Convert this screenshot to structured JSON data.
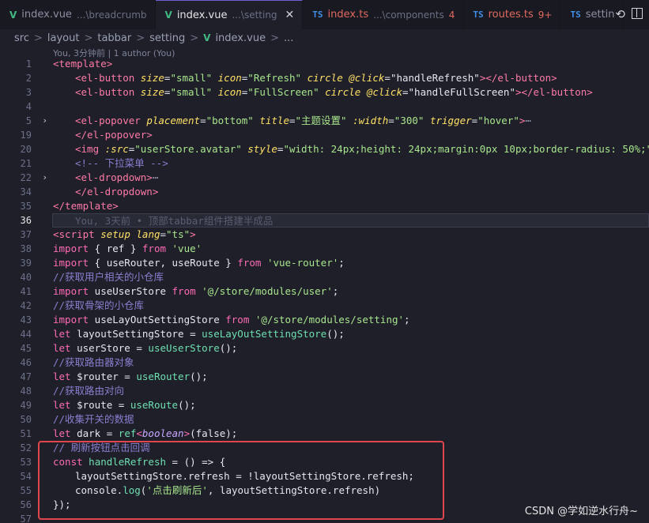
{
  "tabs": [
    {
      "icon": "vue-icon",
      "glyph": "V",
      "name": "index.vue",
      "hint": "...\\breadcrumb",
      "active": false
    },
    {
      "icon": "vue-icon",
      "glyph": "V",
      "name": "index.vue",
      "hint": "...\\setting",
      "active": true,
      "close": "✕"
    },
    {
      "icon": "ts-icon",
      "glyph": "TS",
      "name": "index.ts",
      "hint": "...\\components",
      "badge": "4",
      "active": false
    },
    {
      "icon": "ts-icon",
      "glyph": "TS",
      "name": "routes.ts",
      "badge": "9+",
      "active": false
    },
    {
      "icon": "ts-icon",
      "glyph": "TS",
      "name": "settin",
      "active": false
    }
  ],
  "toolbar": {
    "history_glyph": "⟲"
  },
  "breadcrumb": {
    "parts": [
      "src",
      "layout",
      "tabbar",
      "setting"
    ],
    "sep": ">",
    "file": "index.vue",
    "tail": "..."
  },
  "blame": "You, 3分钟前 | 1 author (You)",
  "line_numbers": [
    "1",
    "2",
    "3",
    "4",
    "5",
    "19",
    "20",
    "21",
    "22",
    "34",
    "35",
    "36",
    "37",
    "38",
    "39",
    "40",
    "41",
    "42",
    "43",
    "44",
    "45",
    "46",
    "47",
    "48",
    "49",
    "50",
    "51",
    "52",
    "53",
    "54",
    "55",
    "56",
    "57"
  ],
  "current_line_index": 11,
  "fold_lines": [
    4,
    8
  ],
  "inline_blame": "You, 3天前 • 顶部tabbar组件搭建半成品",
  "code": {
    "l1": "<template>",
    "l2": {
      "tag": "<el-button",
      "a1": "size",
      "v1": "\"small\"",
      "a2": "icon",
      "v2": "\"Refresh\"",
      "a3": "circle",
      "a4": "@click",
      "v4": "\"handleRefresh\"",
      "end": "></el-button>"
    },
    "l3": {
      "tag": "<el-button",
      "a1": "size",
      "v1": "\"small\"",
      "a2": "icon",
      "v2": "\"FullScreen\"",
      "a3": "circle",
      "a4": "@click",
      "v4": "\"handleFullScreen\"",
      "end": "></el-button>"
    },
    "l5": {
      "tag": "<el-popover",
      "a1": "placement",
      "v1": "\"bottom\"",
      "a2": "title",
      "v2": "\"主题设置\"",
      "a3": ":width",
      "v3": "\"300\"",
      "a4": "trigger",
      "v4": "\"hover\"",
      "end": ">",
      "ellipsis": "⋯"
    },
    "l19": "</el-popover>",
    "l20": {
      "tag": "<img",
      "a1": ":src",
      "v1": "\"userStore.avatar\"",
      "a2": "style",
      "v2": "\"width: 24px;height: 24px;margin:0px 10px;border-radius: 50%;\"",
      "end": ">"
    },
    "l21": "<!-- 下拉菜单 -->",
    "l22": {
      "tag": "<el-dropdown>",
      "ellipsis": "⋯"
    },
    "l34": "</el-dropdown>",
    "l35": "</template>",
    "l37": {
      "tag": "<script",
      "a1": "setup",
      "a2": "lang",
      "v2": "\"ts\"",
      "end": ">"
    },
    "l38": {
      "kw": "import",
      "body": " { ref } ",
      "from": "from",
      "src": "'vue'"
    },
    "l39": {
      "kw": "import",
      "body": " { useRouter, useRoute } ",
      "from": "from",
      "src": "'vue-router'",
      "end": ";"
    },
    "l40": "//获取用户相关的小仓库",
    "l41": {
      "kw": "import",
      "body": " useUserStore ",
      "from": "from",
      "src": "'@/store/modules/user'",
      "end": ";"
    },
    "l42": "//获取骨架的小仓库",
    "l43": {
      "kw": "import",
      "body": " useLayOutSettingStore ",
      "from": "from",
      "src": "'@/store/modules/setting'",
      "end": ";"
    },
    "l44": {
      "kw": "let",
      "name": " layoutSettingStore = ",
      "fn": "useLayOutSettingStore",
      "end": "();"
    },
    "l45": {
      "kw": "let",
      "name": " userStore = ",
      "fn": "useUserStore",
      "end": "();"
    },
    "l46": "//获取路由器对象",
    "l47": {
      "kw": "let",
      "name": " $router = ",
      "fn": "useRouter",
      "end": "();"
    },
    "l48": "//获取路由对向",
    "l49": {
      "kw": "let",
      "name": " $route = ",
      "fn": "useRoute",
      "end": "();"
    },
    "l50": "//收集开关的数据",
    "l51": {
      "kw": "let",
      "name": " dark = ",
      "fn": "ref",
      "lt": "<",
      "type": "boolean",
      "gt": ">",
      "end": "(false);"
    },
    "l52": "// 刷新按钮点击回调",
    "l53": {
      "kw": "const",
      "fn": " handleRefresh",
      "mid": " = () => {"
    },
    "l54": {
      "obj": "layoutSettingStore.refresh = !layoutSettingStore.refresh;"
    },
    "l55": {
      "obj": "console.",
      "fn": "log",
      "open": "(",
      "str": "'点击刷新后'",
      "rest": ", layoutSettingStore.refresh)"
    },
    "l56": "});"
  },
  "watermark": "CSDN @学如逆水行舟~",
  "colors": {
    "highlight_box": "#e0474c",
    "keyword": "#ff6bb5",
    "string": "#a8e58c",
    "function": "#6fe0b0",
    "comment": "#8a7ecf"
  }
}
